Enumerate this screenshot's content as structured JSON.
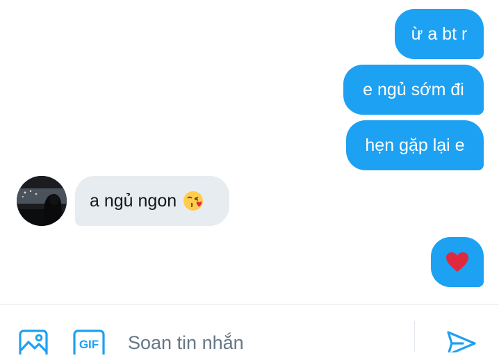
{
  "messages": [
    {
      "direction": "sent",
      "text": "ừ a bt r"
    },
    {
      "direction": "sent",
      "text": "e ngủ sớm đi"
    },
    {
      "direction": "sent",
      "text": "hẹn gặp lại e"
    },
    {
      "direction": "received",
      "text": "a ngủ ngon",
      "emoji": "face-blowing-kiss-icon"
    },
    {
      "direction": "sent",
      "emoji": "red-heart-icon"
    }
  ],
  "composer": {
    "placeholder": "Soan tin nhắn",
    "gif_label": "GIF",
    "icons": [
      "image-icon",
      "gif-icon",
      "send-icon"
    ]
  },
  "colors": {
    "sent_bubble": "#1da1f2",
    "received_bubble": "#e6ecf0",
    "accent": "#1da1f2",
    "placeholder_text": "#657786"
  }
}
